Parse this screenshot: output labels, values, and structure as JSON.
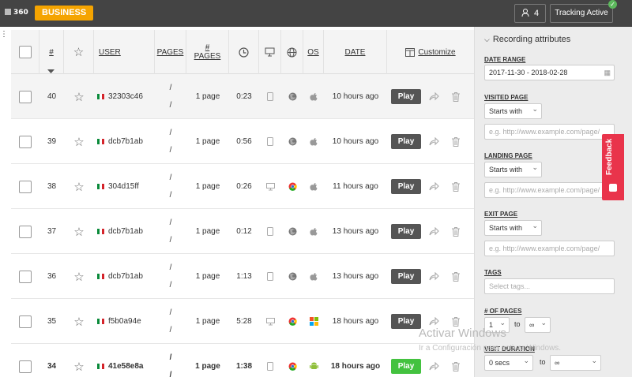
{
  "topbar": {
    "logo_text": "360",
    "plan_badge": "BUSINESS",
    "users_count": "4",
    "tracking_label": "Tracking Active",
    "tracking_check": "✓"
  },
  "table": {
    "headers": {
      "num": "#",
      "user": "USER",
      "pages": "PAGES",
      "num_pages_top": "#",
      "num_pages_bottom": "PAGES",
      "os": "OS",
      "date": "DATE",
      "customize": "Customize"
    },
    "rows": [
      {
        "num": "40",
        "user": "32303c46",
        "pages_top": "/",
        "pages_bottom": "/",
        "num_pages": "1 page",
        "duration": "0:23",
        "device": "mobile-icon",
        "browser": "firefox-icon",
        "os": "apple-icon",
        "date": "10 hours ago",
        "play": "Play"
      },
      {
        "num": "39",
        "user": "dcb7b1ab",
        "pages_top": "/",
        "pages_bottom": "/",
        "num_pages": "1 page",
        "duration": "0:56",
        "device": "mobile-icon",
        "browser": "firefox-icon",
        "os": "apple-icon",
        "date": "10 hours ago",
        "play": "Play"
      },
      {
        "num": "38",
        "user": "304d15ff",
        "pages_top": "/",
        "pages_bottom": "/",
        "num_pages": "1 page",
        "duration": "0:26",
        "device": "desktop-icon",
        "browser": "chrome-icon",
        "os": "apple-icon",
        "date": "11 hours ago",
        "play": "Play"
      },
      {
        "num": "37",
        "user": "dcb7b1ab",
        "pages_top": "/",
        "pages_bottom": "/",
        "num_pages": "1 page",
        "duration": "0:12",
        "device": "mobile-icon",
        "browser": "firefox-icon",
        "os": "apple-icon",
        "date": "13 hours ago",
        "play": "Play"
      },
      {
        "num": "36",
        "user": "dcb7b1ab",
        "pages_top": "/",
        "pages_bottom": "/",
        "num_pages": "1 page",
        "duration": "1:13",
        "device": "mobile-icon",
        "browser": "firefox-icon",
        "os": "apple-icon",
        "date": "13 hours ago",
        "play": "Play"
      },
      {
        "num": "35",
        "user": "f5b0a94e",
        "pages_top": "/",
        "pages_bottom": "/",
        "num_pages": "1 page",
        "duration": "5:28",
        "device": "desktop-icon",
        "browser": "chrome-icon",
        "os": "windows-icon",
        "date": "18 hours ago",
        "play": "Play"
      },
      {
        "num": "34",
        "user": "41e58e8a",
        "pages_top": "/",
        "pages_bottom": "/",
        "num_pages": "1 page",
        "duration": "1:38",
        "device": "mobile-icon",
        "browser": "chrome-icon",
        "os": "android-icon",
        "date": "18 hours ago",
        "play": "Play"
      }
    ]
  },
  "sidebar": {
    "title": "Recording attributes",
    "date_range_label": "DATE RANGE",
    "date_range_value": "2017-11-30 - 2018-02-28",
    "visited_label": "VISITED PAGE",
    "visited_op": "Starts with",
    "visited_placeholder": "e.g. http://www.example.com/page/",
    "landing_label": "LANDING PAGE",
    "landing_op": "Starts with",
    "landing_placeholder": "e.g. http://www.example.com/page/",
    "exit_label": "EXIT PAGE",
    "exit_op": "Starts with",
    "exit_placeholder": "e.g. http://www.example.com/page/",
    "tags_label": "TAGS",
    "tags_placeholder": "Select tags...",
    "num_pages_label": "# OF PAGES",
    "num_pages_from": "1",
    "num_pages_to_word": "to",
    "num_pages_to": "∞",
    "visit_duration_label": "VISIT DURATION",
    "visit_from": "0 secs",
    "visit_to_word": "to",
    "visit_to": "∞"
  },
  "feedback": {
    "label": "Feedback"
  },
  "watermark": {
    "line1": "Activar Windows",
    "line2": "Ir a Configuración para activar Windows."
  },
  "colors": {
    "accent_orange": "#f5a400",
    "play_green": "#43c23f",
    "feedback_red": "#e9344b",
    "topbar": "#444444"
  }
}
